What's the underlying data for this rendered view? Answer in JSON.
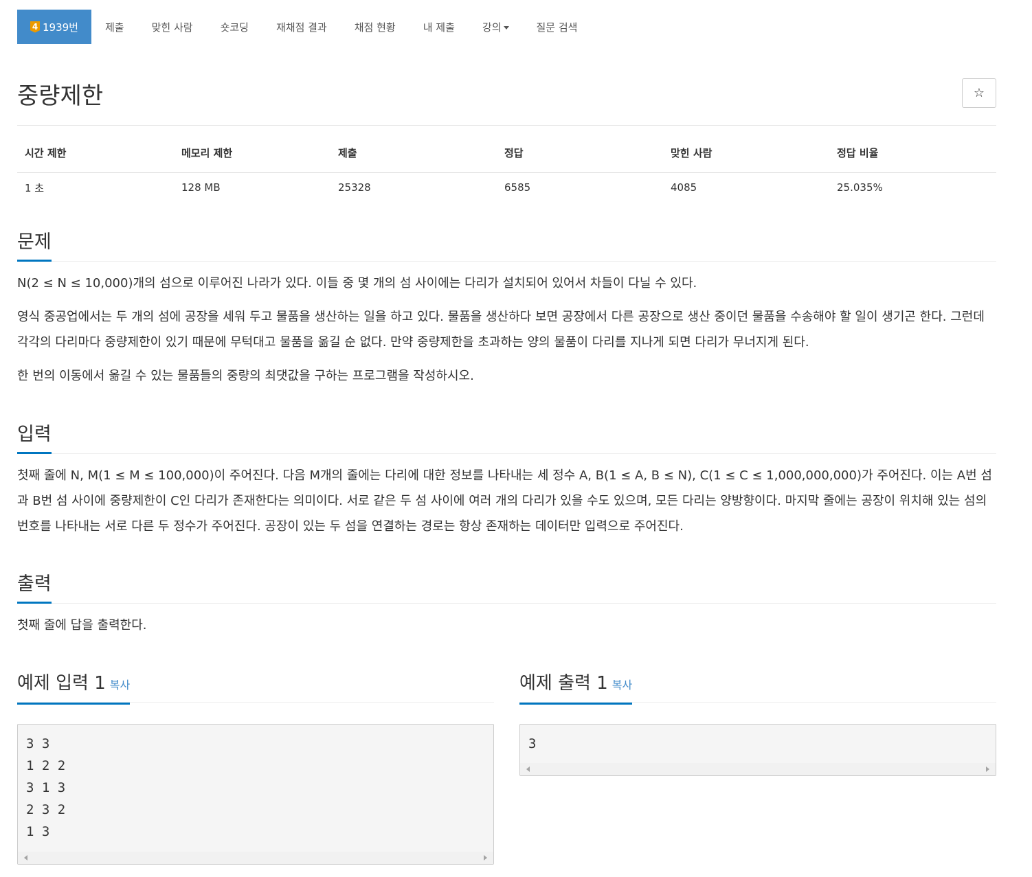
{
  "nav": {
    "active_tier": "4",
    "active_label": "1939번",
    "items": [
      "제출",
      "맞힌 사람",
      "숏코딩",
      "재채점 결과",
      "채점 현황",
      "내 제출",
      "강의",
      "질문 검색"
    ]
  },
  "title": "중량제한",
  "star_glyph": "☆",
  "info": {
    "headers": [
      "시간 제한",
      "메모리 제한",
      "제출",
      "정답",
      "맞힌 사람",
      "정답 비율"
    ],
    "values": [
      "1 초",
      "128 MB",
      "25328",
      "6585",
      "4085",
      "25.035%"
    ]
  },
  "problem": {
    "heading": "문제",
    "paragraphs": [
      "N(2 ≤ N ≤ 10,000)개의 섬으로 이루어진 나라가 있다. 이들 중 몇 개의 섬 사이에는 다리가 설치되어 있어서 차들이 다닐 수 있다.",
      "영식 중공업에서는 두 개의 섬에 공장을 세워 두고 물품을 생산하는 일을 하고 있다. 물품을 생산하다 보면 공장에서 다른 공장으로 생산 중이던 물품을 수송해야 할 일이 생기곤 한다. 그런데 각각의 다리마다 중량제한이 있기 때문에 무턱대고 물품을 옮길 순 없다. 만약 중량제한을 초과하는 양의 물품이 다리를 지나게 되면 다리가 무너지게 된다.",
      "한 번의 이동에서 옮길 수 있는 물품들의 중량의 최댓값을 구하는 프로그램을 작성하시오."
    ]
  },
  "input": {
    "heading": "입력",
    "text": "첫째 줄에 N, M(1 ≤ M ≤ 100,000)이 주어진다. 다음 M개의 줄에는 다리에 대한 정보를 나타내는 세 정수 A, B(1 ≤ A, B ≤ N), C(1 ≤ C ≤ 1,000,000,000)가 주어진다. 이는 A번 섬과 B번 섬 사이에 중량제한이 C인 다리가 존재한다는 의미이다. 서로 같은 두 섬 사이에 여러 개의 다리가 있을 수도 있으며, 모든 다리는 양방향이다. 마지막 줄에는 공장이 위치해 있는 섬의 번호를 나타내는 서로 다른 두 정수가 주어진다. 공장이 있는 두 섬을 연결하는 경로는 항상 존재하는 데이터만 입력으로 주어진다."
  },
  "output": {
    "heading": "출력",
    "text": "첫째 줄에 답을 출력한다."
  },
  "sample_input": {
    "heading": "예제 입력 1",
    "copy": "복사",
    "lines": [
      "3 3",
      "1 2 2",
      "3 1 3",
      "2 3 2",
      "1 3"
    ]
  },
  "sample_output": {
    "heading": "예제 출력 1",
    "copy": "복사",
    "lines": [
      "3"
    ]
  }
}
